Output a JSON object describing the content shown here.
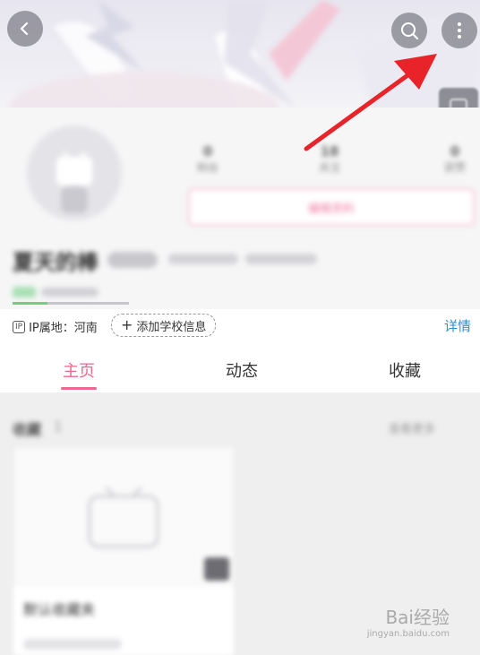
{
  "header": {
    "back_icon": "chevron-left-icon",
    "search_icon": "search-icon",
    "more_icon": "more-vertical-icon"
  },
  "profile": {
    "stats": [
      {
        "value": "0",
        "label": "粉丝"
      },
      {
        "value": "18",
        "label": "关注"
      },
      {
        "value": "0",
        "label": "获赞"
      }
    ],
    "edit_label": "编辑资料",
    "name": "夏天的棒"
  },
  "ip_row": {
    "ip_text": "IP属地：河南",
    "add_school_label": "添加学校信息",
    "detail_label": "详情"
  },
  "tabs": [
    {
      "label": "主页",
      "active": true
    },
    {
      "label": "动态",
      "active": false
    },
    {
      "label": "收藏",
      "active": false
    }
  ],
  "favorites": {
    "section_title": "收藏",
    "section_count": "1",
    "view_all": "查看更多",
    "card_title": "默认收藏夹"
  },
  "watermark": {
    "brand": "Bai经验",
    "url": "jingyan.baidu.com"
  },
  "colors": {
    "accent_pink": "#f0668f",
    "link_blue": "#2e8fd0",
    "annotation_arrow": "#e8232a"
  }
}
